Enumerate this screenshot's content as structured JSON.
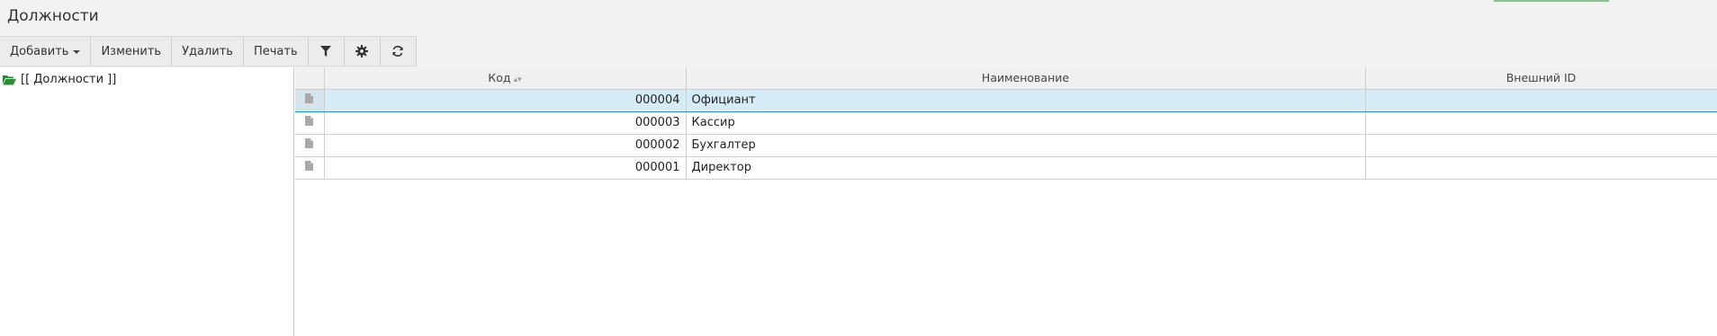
{
  "page": {
    "title": "Должности"
  },
  "toolbar": {
    "add_label": "Добавить",
    "edit_label": "Изменить",
    "delete_label": "Удалить",
    "print_label": "Печать"
  },
  "tree": {
    "root_label": "[[ Должности ]]"
  },
  "grid": {
    "columns": {
      "code": "Код",
      "name": "Наименование",
      "external_id": "Внешний ID"
    },
    "rows": [
      {
        "code": "000004",
        "name": "Официант",
        "external_id": ""
      },
      {
        "code": "000003",
        "name": "Кассир",
        "external_id": ""
      },
      {
        "code": "000002",
        "name": "Бухгалтер",
        "external_id": ""
      },
      {
        "code": "000001",
        "name": "Директор",
        "external_id": ""
      }
    ]
  },
  "colors": {
    "selection_bg": "#d6ecf6",
    "selection_border": "#2a8fd0",
    "folder_icon": "#2e8b3a"
  }
}
